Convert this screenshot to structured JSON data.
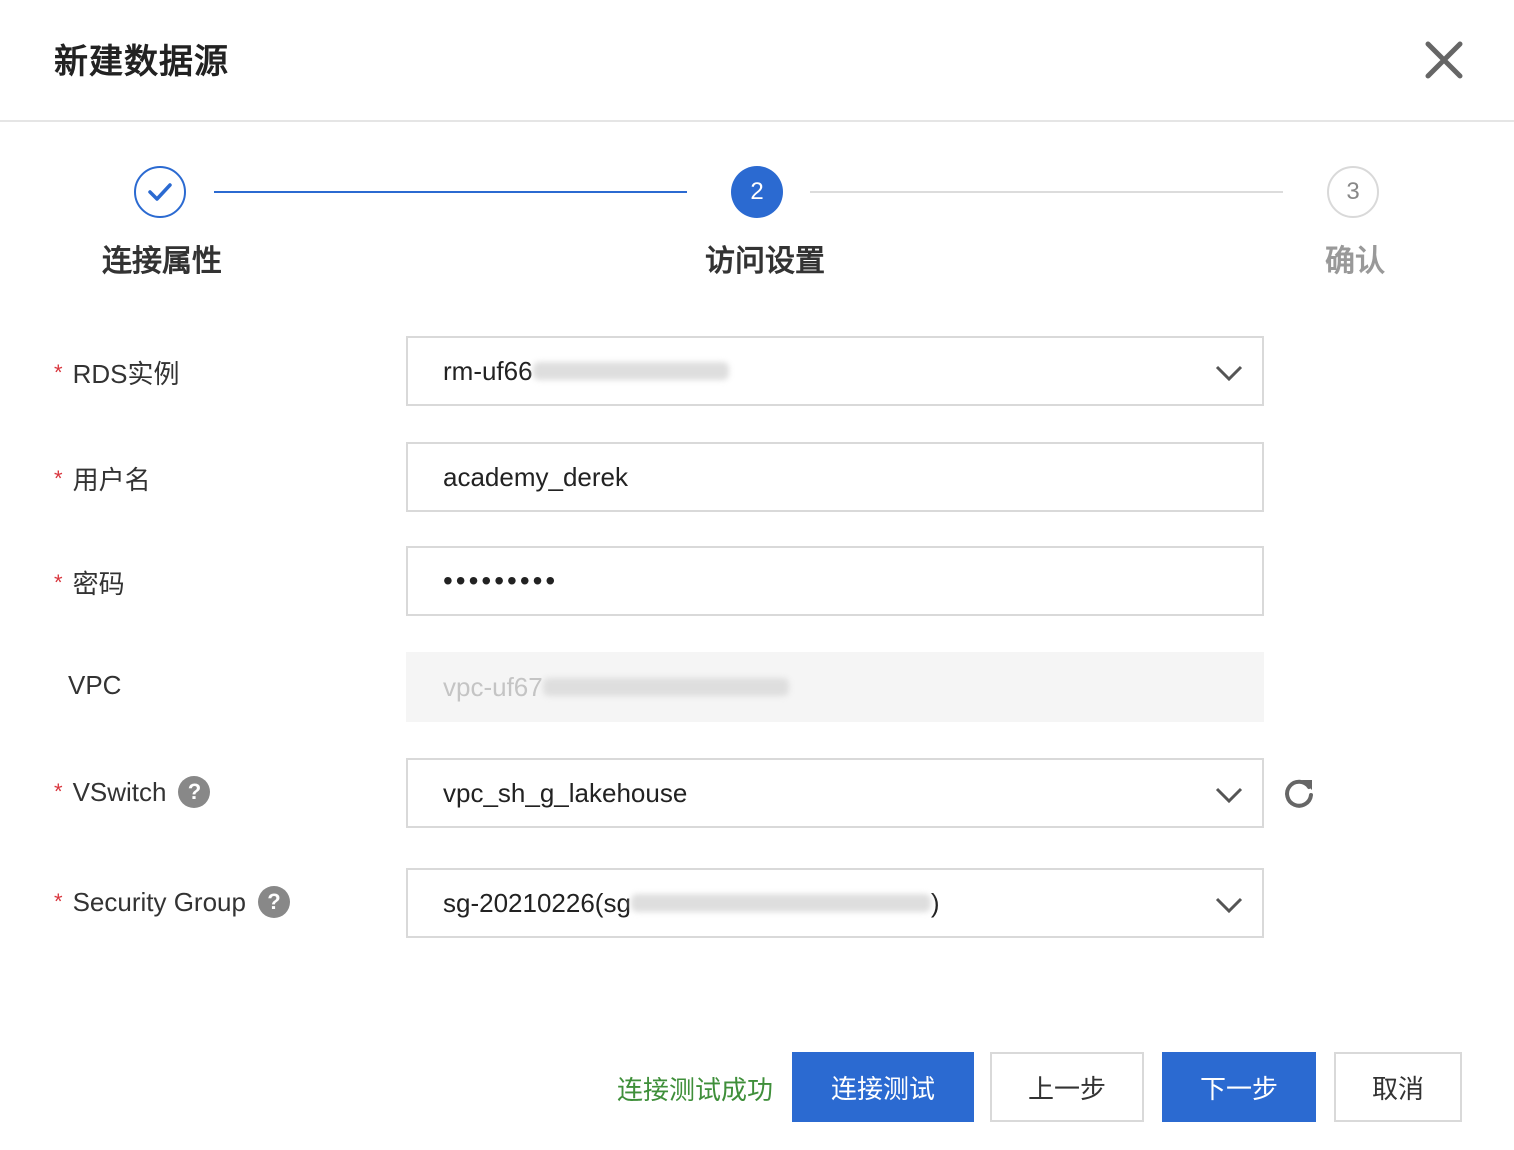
{
  "dialog": {
    "title": "新建数据源"
  },
  "steps": [
    {
      "number": "1",
      "label": "连接属性",
      "state": "done"
    },
    {
      "number": "2",
      "label": "访问设置",
      "state": "active"
    },
    {
      "number": "3",
      "label": "确认",
      "state": "wait"
    }
  ],
  "form": {
    "rds": {
      "label": "RDS实例",
      "value": "rm-uf66"
    },
    "username": {
      "label": "用户名",
      "value": "academy_derek"
    },
    "password": {
      "label": "密码",
      "value": "•••••••••"
    },
    "vpc": {
      "label": "VPC",
      "value": "vpc-uf67"
    },
    "vswitch": {
      "label": "VSwitch",
      "value": "vpc_sh_g_lakehouse"
    },
    "security_group": {
      "label": "Security Group",
      "value_prefix": "sg-20210226(sg",
      "value_suffix": ")"
    }
  },
  "help_glyph": "?",
  "required_mark": "*",
  "footer": {
    "status": "连接测试成功",
    "test_button": "连接测试",
    "prev_button": "上一步",
    "next_button": "下一步",
    "cancel_button": "取消"
  },
  "colors": {
    "primary": "#2b6ad1",
    "success": "#3f8f3a",
    "required": "#d9363e",
    "border": "#d9d9d9"
  }
}
